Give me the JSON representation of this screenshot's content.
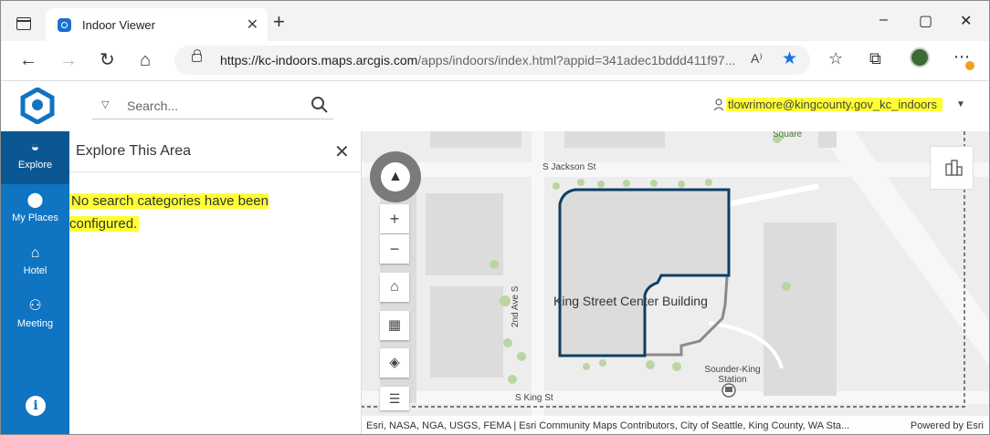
{
  "browser": {
    "tab_title": "Indoor Viewer",
    "url_host": "https://kc-indoors.maps.arcgis.com",
    "url_path": "/apps/indoors/index.html?appid=341adec1bddd411f97...",
    "read_aloud_label": "A⁾",
    "new_tab": "+",
    "tab_close": "✕",
    "minimize": "–",
    "maximize": "▢",
    "close": "✕"
  },
  "header": {
    "search_placeholder": "Search...",
    "user_name": "tlowrimore@kingcounty.gov_kc_indoors"
  },
  "rail": {
    "items": [
      {
        "label": "Explore",
        "icon": "globe-icon",
        "glyph": "◒"
      },
      {
        "label": "My Places",
        "icon": "pin-icon",
        "glyph": "⬤"
      },
      {
        "label": "Hotel",
        "icon": "hotel-icon",
        "glyph": "⌂"
      },
      {
        "label": "Meeting",
        "icon": "meeting-icon",
        "glyph": "⚇"
      }
    ],
    "info": "i"
  },
  "panel": {
    "title": "Explore This Area",
    "message": "No search categories have been configured."
  },
  "map": {
    "building_label": "King Street Center Building",
    "streets": {
      "jackson": "S Jackson St",
      "king": "S King St",
      "second_ave": "2nd Ave S"
    },
    "station": "Sounder-King Station",
    "square": "Square",
    "attribution": "Esri, NASA, NGA, USGS, FEMA | Esri Community Maps Contributors, City of Seattle, King County, WA Sta...",
    "powered_by": "Powered by Esri",
    "colors": {
      "building_outline": "#0d3f63",
      "building_fill": "#dcdcdc",
      "highlight": "#ffff33",
      "rail": "#0f74c1"
    }
  }
}
